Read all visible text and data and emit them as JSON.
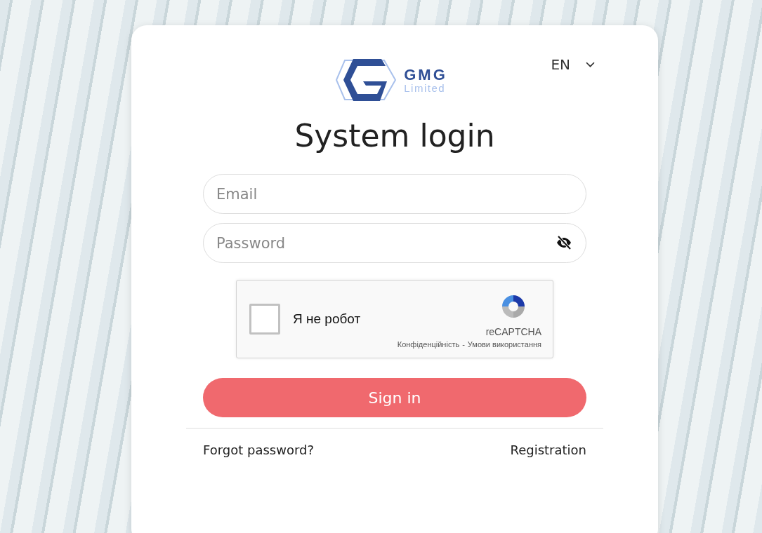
{
  "language": {
    "label": "EN"
  },
  "logo": {
    "name": "GMG",
    "subtitle": "Limited"
  },
  "title": "System login",
  "email": {
    "placeholder": "Email"
  },
  "password": {
    "placeholder": "Password"
  },
  "captcha": {
    "checked": false,
    "label": "Я не робот",
    "brand": "reCAPTCHA",
    "privacy": "Конфіденційність",
    "separator": "-",
    "terms": "Умови використання"
  },
  "submit": "Sign in",
  "links": {
    "forgot": "Forgot password?",
    "register": "Registration"
  }
}
